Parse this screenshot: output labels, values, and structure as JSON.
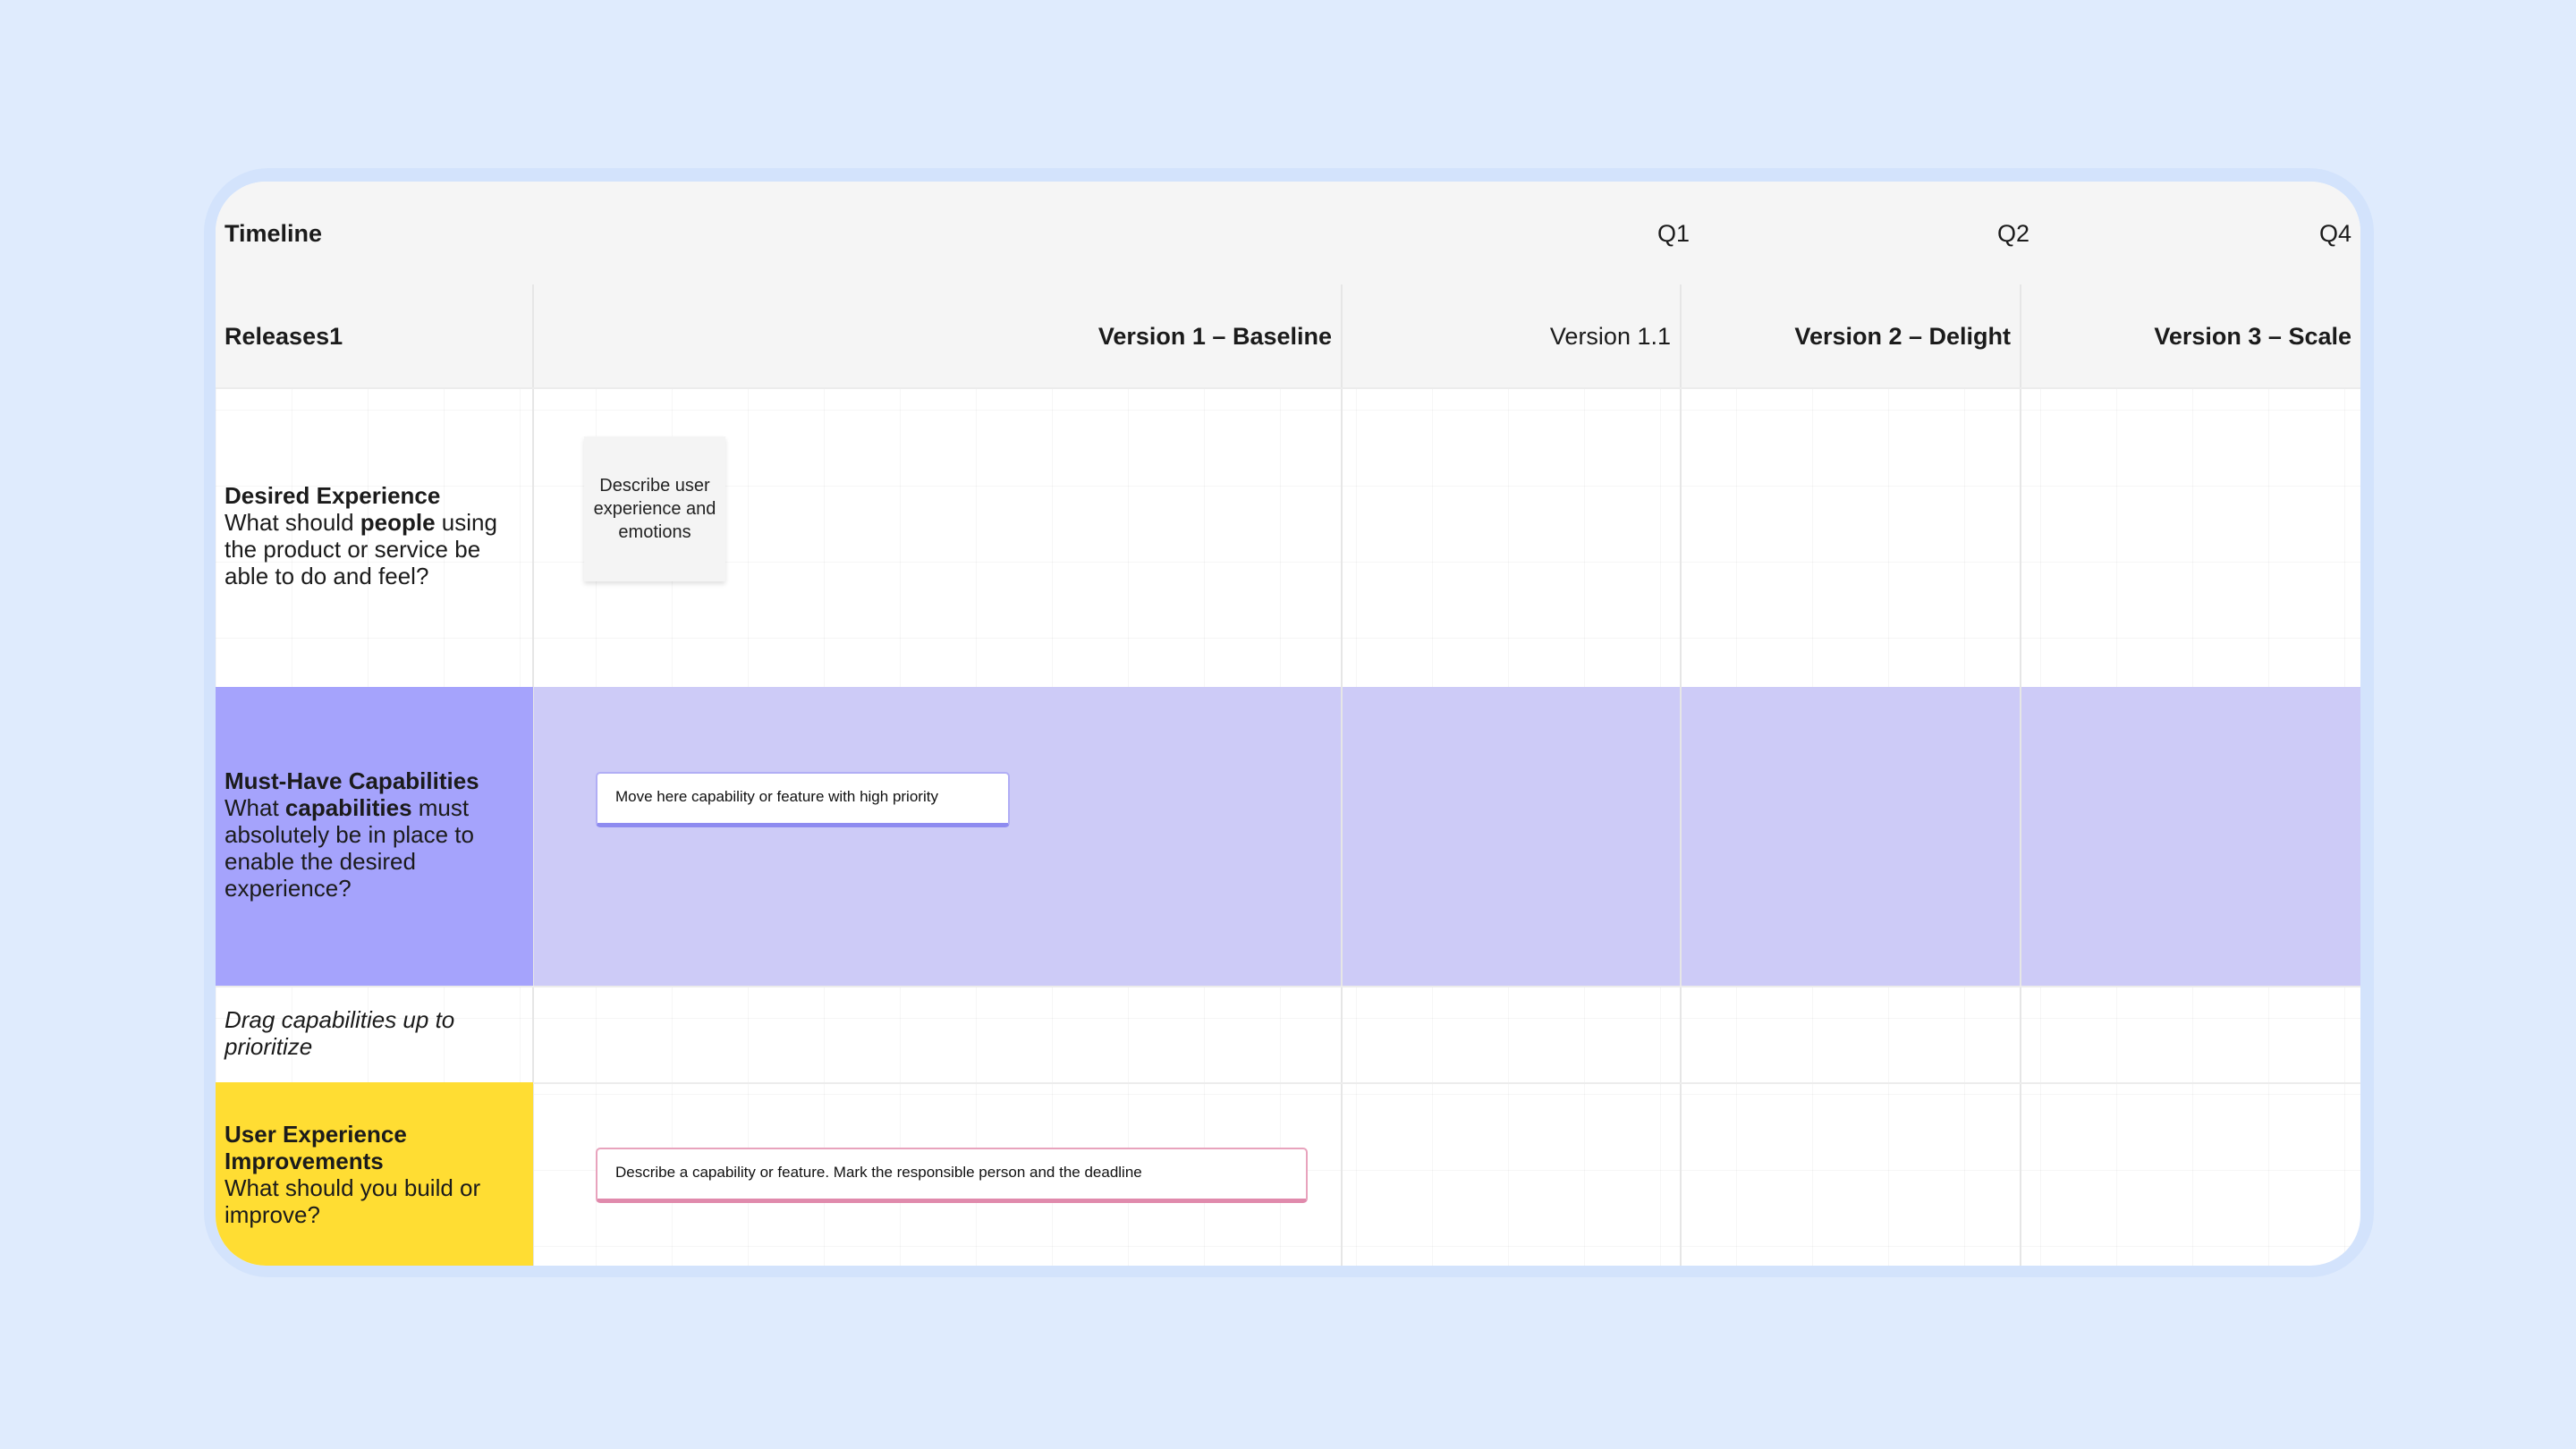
{
  "header": {
    "timeline_label": "Timeline",
    "quarters": [
      "Q1",
      "Q2",
      "Q4"
    ],
    "releases_label": "Releases1",
    "versions": [
      {
        "label": "Version 1 – Baseline",
        "bold": true
      },
      {
        "label": "Version 1.1",
        "bold": false
      },
      {
        "label": "Version 2 – Delight",
        "bold": true
      },
      {
        "label": "Version 3 – Scale",
        "bold": true
      }
    ]
  },
  "rows": {
    "desired": {
      "title": "Desired Experience",
      "q_pre": "What should ",
      "q_bold": "people",
      "q_post": " using the product or service be able to do and feel?",
      "sticky": "Describe user experience and emotions"
    },
    "must": {
      "title": "Must-Have Capabilities",
      "q_pre": "What ",
      "q_bold": "capabilities",
      "q_post": " must absolutely be in place to enable the desired experience?",
      "card": "Move here capability or feature with high priority"
    },
    "drag": {
      "text": "Drag capabilities up to prioritize"
    },
    "ux": {
      "title": "User Experience Improvements",
      "question": "What should you build or improve?",
      "card": "Describe a capability or feature. Mark the responsible person and the deadline"
    }
  },
  "colors": {
    "page_bg": "#dfebfd",
    "must_band": "#cdcbf7",
    "must_label": "#a5a3fc",
    "ux_label": "#ffdd33"
  }
}
